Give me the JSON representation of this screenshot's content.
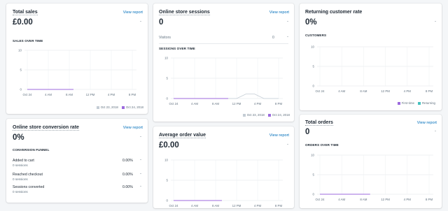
{
  "view_report": "View report",
  "dash": "-",
  "axis": {
    "y": [
      "10",
      "5",
      "0"
    ],
    "x": [
      "Oct 24",
      "4 AM",
      "8 AM",
      "12 PM",
      "4 PM",
      "8 PM"
    ]
  },
  "cards": {
    "total_sales": {
      "title": "Total sales",
      "value": "£0.00",
      "section": "SALES OVER TIME",
      "legend": [
        "Oct 23, 2018",
        "Oct 24, 2018"
      ]
    },
    "online_sessions": {
      "title": "Online store sessions",
      "value": "0",
      "visitors_label": "Visitors",
      "visitors_value": "0",
      "section": "SESSIONS OVER TIME",
      "legend": [
        "Oct 23, 2018",
        "Oct 24, 2018"
      ]
    },
    "returning": {
      "title": "Returning customer rate",
      "value": "0%",
      "section": "CUSTOMERS",
      "legend": [
        "First-time",
        "Returning"
      ]
    },
    "conversion": {
      "title": "Online store conversion rate",
      "value": "0%",
      "section": "CONVERSION FUNNEL",
      "rows": [
        {
          "label": "Added to cart",
          "sub": "0 sessions",
          "pct": "0.00%"
        },
        {
          "label": "Reached checkout",
          "sub": "0 sessions",
          "pct": "0.00%"
        },
        {
          "label": "Sessions converted",
          "sub": "0 sessions",
          "pct": "0.00%"
        }
      ]
    },
    "aov": {
      "title": "Average order value",
      "value": "£0.00"
    },
    "orders": {
      "title": "Total orders",
      "value": "0",
      "section": "ORDERS OVER TIME"
    }
  },
  "chart_data": [
    {
      "type": "line",
      "title": "Sales over time",
      "categories": [
        "Oct 24",
        "4 AM",
        "8 AM",
        "12 PM",
        "4 PM",
        "8 PM"
      ],
      "ylim": [
        0,
        10
      ],
      "series": [
        {
          "name": "Oct 23, 2018",
          "values": [
            0,
            0,
            0,
            0,
            0,
            0
          ]
        },
        {
          "name": "Oct 24, 2018",
          "values": [
            0,
            0,
            0,
            0,
            0,
            0
          ]
        }
      ]
    },
    {
      "type": "line",
      "title": "Sessions over time",
      "categories": [
        "Oct 24",
        "4 AM",
        "8 AM",
        "12 PM",
        "4 PM",
        "8 PM"
      ],
      "ylim": [
        0,
        10
      ],
      "series": [
        {
          "name": "Oct 23, 2018",
          "values": [
            0,
            0,
            0,
            0,
            0,
            0
          ]
        },
        {
          "name": "Oct 24, 2018",
          "values": [
            0,
            0,
            0,
            0,
            0,
            0
          ]
        }
      ]
    },
    {
      "type": "bar",
      "title": "Customers",
      "categories": [
        "Oct 24",
        "4 AM",
        "8 AM",
        "12 PM",
        "4 PM",
        "8 PM"
      ],
      "ylim": [
        0,
        10
      ],
      "series": [
        {
          "name": "First-time",
          "values": [
            0,
            0,
            0,
            0,
            0,
            0
          ]
        },
        {
          "name": "Returning",
          "values": [
            0,
            0,
            0,
            0,
            0,
            0
          ]
        }
      ]
    },
    {
      "type": "line",
      "title": "Average order value",
      "categories": [
        "Oct 24",
        "4 AM",
        "8 AM",
        "12 PM",
        "4 PM",
        "8 PM"
      ],
      "ylim": [
        0,
        10
      ],
      "series": [
        {
          "values": [
            0,
            0,
            0,
            0,
            0,
            0
          ]
        }
      ]
    },
    {
      "type": "line",
      "title": "Orders over time",
      "categories": [
        "Oct 24",
        "4 AM",
        "8 AM",
        "12 PM",
        "4 PM",
        "8 PM"
      ],
      "ylim": [
        0,
        10
      ],
      "series": [
        {
          "values": [
            0,
            0,
            0,
            0,
            0,
            0
          ]
        }
      ]
    }
  ],
  "colors": {
    "primary_series": "#9c6ade",
    "comparison_series": "#c4cdd5",
    "returning": "#47c1bf",
    "link": "#006fbb"
  }
}
